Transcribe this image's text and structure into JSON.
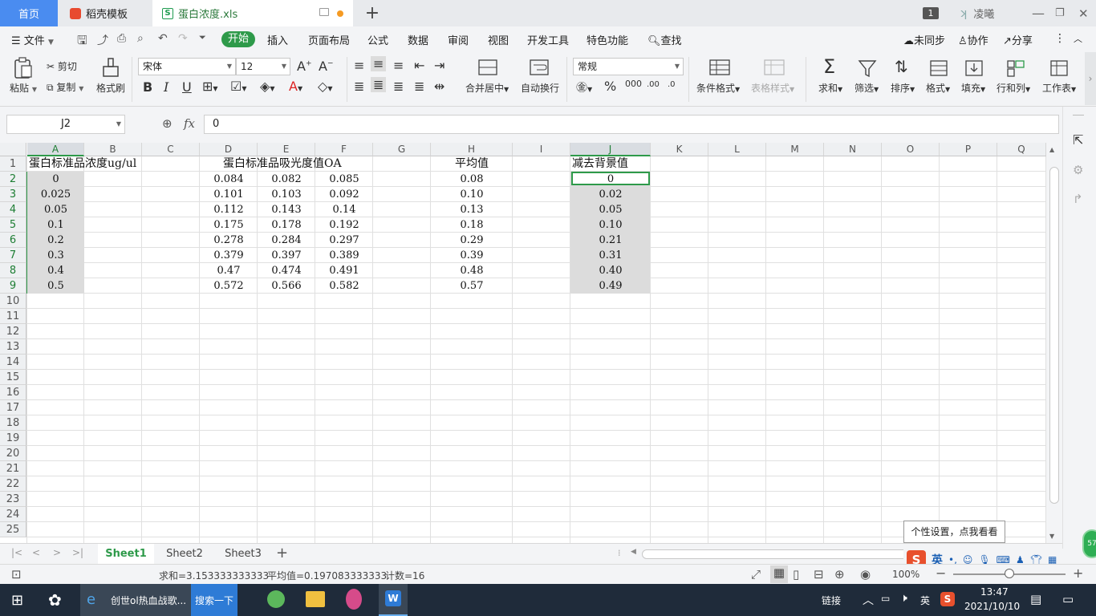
{
  "tabs": {
    "home": "首页",
    "daoke": "稻壳模板",
    "file": "蛋白浓度.xls",
    "badge": "1",
    "user": "凌曦"
  },
  "menu": {
    "file": "文件",
    "start": "开始",
    "items": [
      "插入",
      "页面布局",
      "公式",
      "数据",
      "审阅",
      "视图",
      "开发工具",
      "特色功能"
    ],
    "search": "查找",
    "unsync": "未同步",
    "collab": "协作",
    "share": "分享"
  },
  "ribbon": {
    "paste": "粘贴",
    "cut": "剪切",
    "copy": "复制",
    "format_painter": "格式刷",
    "font_name": "宋体",
    "font_size": "12",
    "number_format": "常规",
    "merge": "合并居中",
    "wrap": "自动换行",
    "cond_format": "条件格式",
    "table_style": "表格样式",
    "sum": "求和",
    "filter": "筛选",
    "sort": "排序",
    "format": "格式",
    "fill": "填充",
    "rowcol": "行和列",
    "worksheet": "工作表"
  },
  "formula": {
    "namebox": "J2",
    "fx": "fx",
    "value": "0"
  },
  "grid": {
    "columns": [
      "A",
      "B",
      "C",
      "D",
      "E",
      "F",
      "G",
      "H",
      "I",
      "J",
      "K",
      "L",
      "M",
      "N",
      "O",
      "P",
      "Q"
    ],
    "rows": [
      "1",
      "2",
      "3",
      "4",
      "5",
      "6",
      "7",
      "8",
      "9",
      "10",
      "11",
      "12",
      "13",
      "14",
      "15",
      "16",
      "17",
      "18",
      "19",
      "20",
      "21",
      "22",
      "23",
      "24",
      "25"
    ],
    "headers": {
      "a1": "蛋白标准品浓度ug/ul",
      "d1": "蛋白标准品吸光度值OA",
      "h1": "平均值",
      "j1": "减去背景值"
    },
    "colA": [
      "0",
      "0.025",
      "0.05",
      "0.1",
      "0.2",
      "0.3",
      "0.4",
      "0.5"
    ],
    "colD": [
      "0.084",
      "0.101",
      "0.112",
      "0.175",
      "0.278",
      "0.379",
      "0.47",
      "0.572"
    ],
    "colE": [
      "0.082",
      "0.103",
      "0.143",
      "0.178",
      "0.284",
      "0.397",
      "0.474",
      "0.566"
    ],
    "colF": [
      "0.085",
      "0.092",
      "0.14",
      "0.192",
      "0.297",
      "0.389",
      "0.491",
      "0.582"
    ],
    "colH": [
      "0.08",
      "0.10",
      "0.13",
      "0.18",
      "0.29",
      "0.39",
      "0.48",
      "0.57"
    ],
    "colJ": [
      "0",
      "0.02",
      "0.05",
      "0.10",
      "0.21",
      "0.31",
      "0.40",
      "0.49"
    ]
  },
  "sheets": [
    "Sheet1",
    "Sheet2",
    "Sheet3"
  ],
  "status": {
    "sum": "求和=3.153333333333",
    "avg": "平均值=0.197083333333",
    "count": "计数=16",
    "zoom": "100%"
  },
  "tooltip": "个性设置，点我看看",
  "ime": "英",
  "taskbar": {
    "browser_title": "创世ol热血战歌...",
    "search_btn": "搜索一下",
    "link": "链接",
    "lang": "英",
    "time": "13:47",
    "date": "2021/10/10"
  },
  "colors": {
    "accent": "#2e9a4a",
    "home_tab": "#4a8cf0",
    "taskbar": "#1f2b3a"
  }
}
